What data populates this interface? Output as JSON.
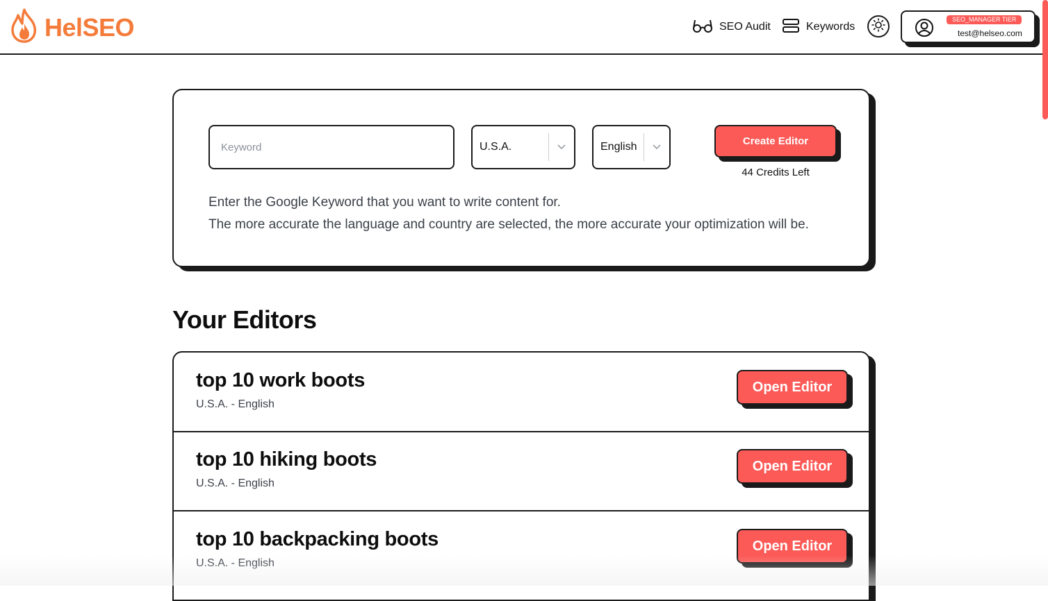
{
  "header": {
    "logo_text": "HelSEO",
    "nav": [
      {
        "label": "SEO Audit",
        "icon": "glasses-icon"
      },
      {
        "label": "Keywords",
        "icon": "list-icon"
      }
    ],
    "theme_icon": "sun-icon",
    "account": {
      "tier": "SEO_MANAGER TIER",
      "email": "test@helseo.com",
      "icon": "user-circle-icon"
    }
  },
  "creator": {
    "keyword_placeholder": "Keyword",
    "keyword_value": "",
    "country": "U.S.A.",
    "language": "English",
    "create_label": "Create Editor",
    "credits": "44 Credits Left",
    "help_line1": "Enter the Google Keyword that you want to write content for.",
    "help_line2": "The more accurate the language and country are selected, the more accurate your optimization will be."
  },
  "editors": {
    "title": "Your Editors",
    "items": [
      {
        "name": "top 10 work boots",
        "meta": "U.S.A. - English",
        "button": "Open Editor"
      },
      {
        "name": "top 10 hiking boots",
        "meta": "U.S.A. - English",
        "button": "Open Editor"
      },
      {
        "name": "top 10 backpacking boots",
        "meta": "U.S.A. - English",
        "button": "Open Editor"
      }
    ]
  },
  "colors": {
    "accent": "#fb5a57",
    "logo": "#f47b3a",
    "border": "#1a1a1a"
  }
}
